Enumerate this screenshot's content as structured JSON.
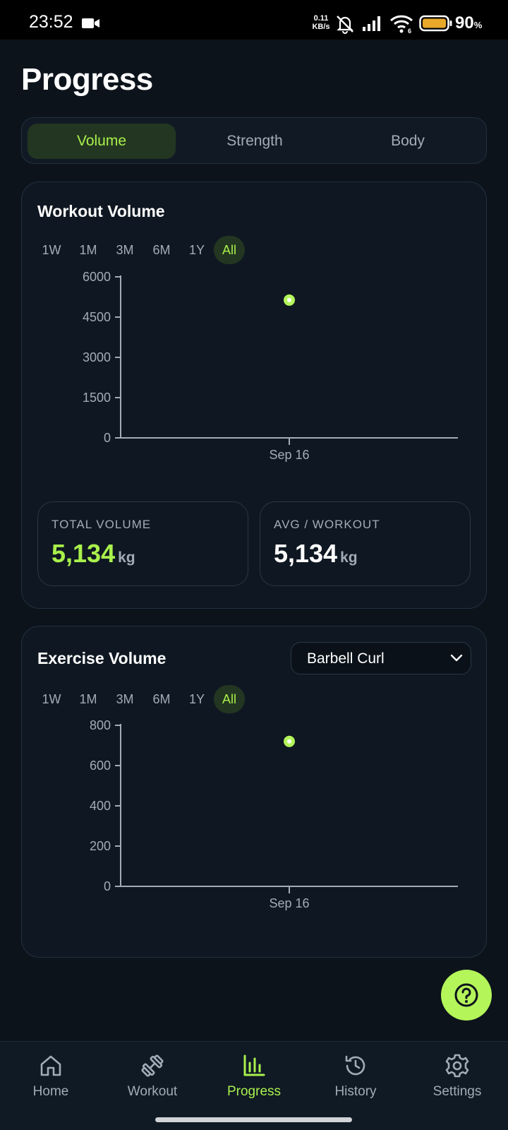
{
  "status_bar": {
    "time": "23:52",
    "net_speed_value": "0.11",
    "net_speed_unit": "KB/s",
    "wifi_badge": "6",
    "battery_percent": "90",
    "battery_symbol": "%",
    "icons": [
      "video-camera-icon",
      "mute-bell-icon",
      "signal-icon",
      "wifi-icon",
      "battery-icon"
    ]
  },
  "page": {
    "title": "Progress"
  },
  "tabs": [
    {
      "label": "Volume",
      "active": true
    },
    {
      "label": "Strength",
      "active": false
    },
    {
      "label": "Body",
      "active": false
    }
  ],
  "workout_volume": {
    "title": "Workout Volume",
    "ranges": [
      "1W",
      "1M",
      "3M",
      "6M",
      "1Y",
      "All"
    ],
    "selected_range": "All",
    "total_label": "TOTAL VOLUME",
    "total_value": "5,134",
    "total_unit": "kg",
    "avg_label": "AVG / WORKOUT",
    "avg_value": "5,134",
    "avg_unit": "kg"
  },
  "exercise_volume": {
    "title": "Exercise Volume",
    "selected_exercise": "Barbell Curl",
    "ranges": [
      "1W",
      "1M",
      "3M",
      "6M",
      "1Y",
      "All"
    ],
    "selected_range": "All"
  },
  "chart_data": [
    {
      "type": "scatter",
      "x": [
        "Sep 16"
      ],
      "y": [
        5134
      ],
      "yticks": [
        "0",
        "1500",
        "3000",
        "4500",
        "6000"
      ],
      "ylim": [
        0,
        6000
      ],
      "xticks": [
        "Sep 16"
      ],
      "grid": false,
      "point_color": "#b4f55a"
    },
    {
      "type": "scatter",
      "x": [
        "Sep 16"
      ],
      "y": [
        720
      ],
      "yticks": [
        "0",
        "200",
        "400",
        "600",
        "800"
      ],
      "ylim": [
        0,
        800
      ],
      "xticks": [
        "Sep 16"
      ],
      "grid": false,
      "point_color": "#b4f55a"
    }
  ],
  "fab": {
    "icon": "help-circle-icon"
  },
  "bottom_nav": [
    {
      "label": "Home",
      "icon": "home-icon",
      "active": false
    },
    {
      "label": "Workout",
      "icon": "dumbbell-icon",
      "active": false
    },
    {
      "label": "Progress",
      "icon": "bar-chart-icon",
      "active": true
    },
    {
      "label": "History",
      "icon": "history-icon",
      "active": false
    },
    {
      "label": "Settings",
      "icon": "gear-icon",
      "active": false
    }
  ],
  "colors": {
    "accent": "#a9f04c",
    "background": "#0c131b",
    "card": "#0f1822",
    "muted_text": "#a2acb8"
  }
}
